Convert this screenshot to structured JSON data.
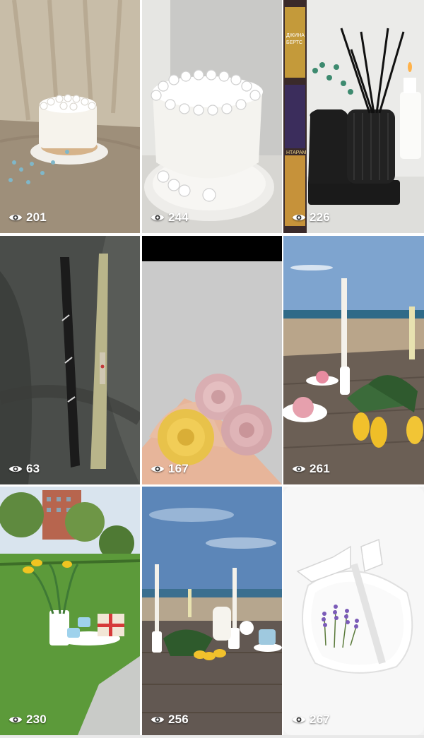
{
  "tiles": [
    {
      "views": "201",
      "icon": "eye-icon"
    },
    {
      "views": "244",
      "icon": "eye-icon"
    },
    {
      "views": "226",
      "icon": "eye-icon"
    },
    {
      "views": "63",
      "icon": "eye-icon"
    },
    {
      "views": "167",
      "icon": "eye-icon"
    },
    {
      "views": "261",
      "icon": "eye-icon"
    },
    {
      "views": "230",
      "icon": "eye-icon"
    },
    {
      "views": "256",
      "icon": "eye-icon"
    },
    {
      "views": "267",
      "icon": "eye-icon"
    }
  ],
  "poster_text": {
    "top": "ДЖИНА\nБЕРТС",
    "bottom": "НТАРАМ"
  },
  "colors": {
    "background": "#ffffff",
    "overlay_text": "#ffffff"
  }
}
